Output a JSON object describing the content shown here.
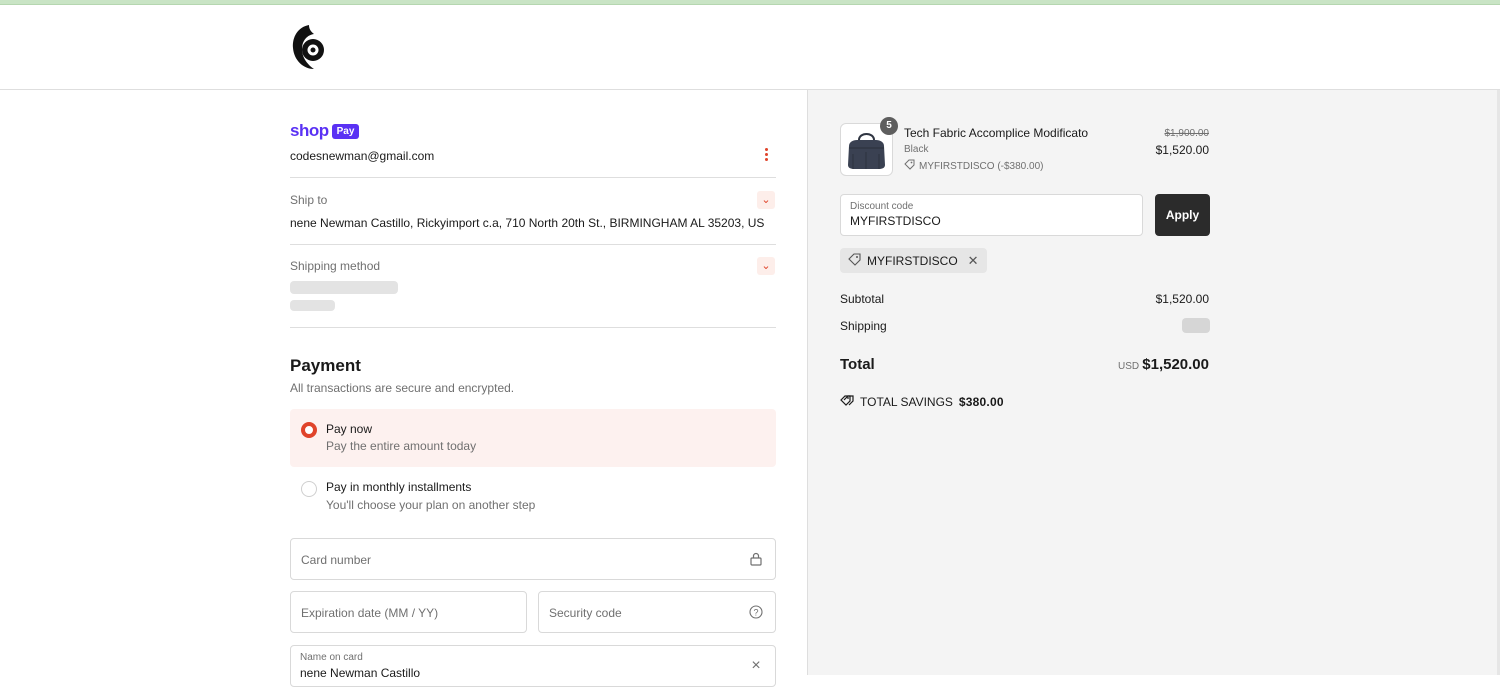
{
  "colors": {
    "accent": "#e0442b",
    "shop_pay": "#5a31f4",
    "apply_bg": "#2b2b2b"
  },
  "shop_pay": {
    "brand": "shop",
    "badge": "Pay"
  },
  "account": {
    "email": "codesnewman@gmail.com"
  },
  "ship_to": {
    "label": "Ship to",
    "address": "nene Newman Castillo, Rickyimport c.a, 710 North 20th St., BIRMINGHAM AL 35203, US"
  },
  "shipping_method": {
    "label": "Shipping method"
  },
  "payment": {
    "title": "Payment",
    "subtitle": "All transactions are secure and encrypted.",
    "options": [
      {
        "title": "Pay now",
        "subtitle": "Pay the entire amount today",
        "selected": true
      },
      {
        "title": "Pay in monthly installments",
        "subtitle": "You'll choose your plan on another step",
        "selected": false
      }
    ],
    "card_number_placeholder": "Card number",
    "expiration_placeholder": "Expiration date (MM / YY)",
    "security_code_placeholder": "Security code",
    "name_label": "Name on card",
    "name_value": "nene Newman Castillo"
  },
  "order": {
    "quantity": "5",
    "product_name": "Tech Fabric Accomplice Modificato",
    "variant": "Black",
    "discount_line": "MYFIRSTDISCO (-$380.00)",
    "original_price": "$1,900.00",
    "price": "$1,520.00"
  },
  "discount": {
    "label": "Discount code",
    "value": "MYFIRSTDISCO",
    "apply_label": "Apply",
    "chip": "MYFIRSTDISCO"
  },
  "summary": {
    "subtotal_label": "Subtotal",
    "subtotal_value": "$1,520.00",
    "shipping_label": "Shipping",
    "total_label": "Total",
    "currency": "USD",
    "total_value": "$1,520.00",
    "savings_label": "TOTAL SAVINGS",
    "savings_value": "$380.00"
  }
}
